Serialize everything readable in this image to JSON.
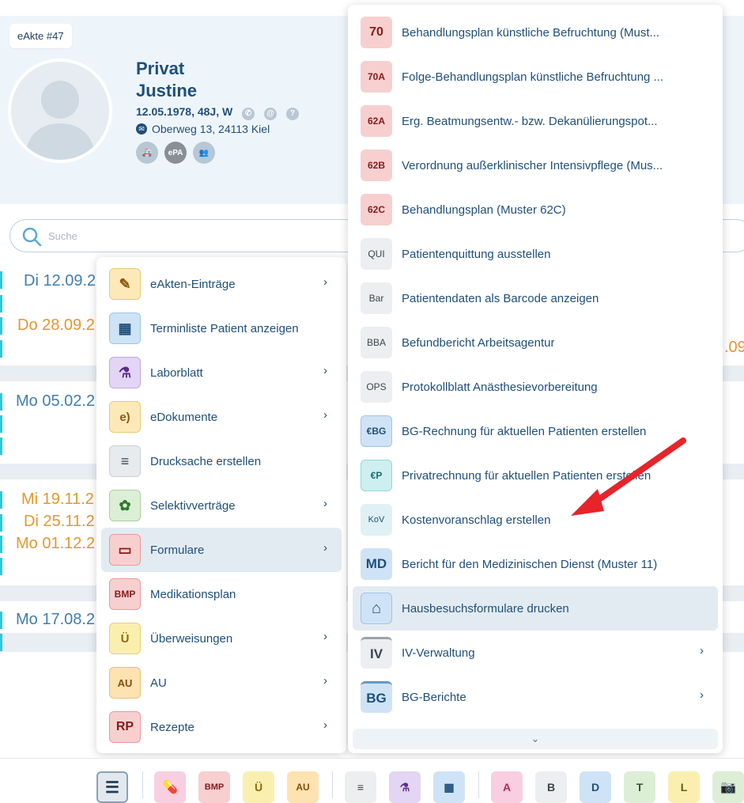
{
  "header": {
    "ekte_label": "eAkte #47",
    "last_name": "Privat",
    "first_name": "Justine",
    "dob_line": "12.05.1978, 48J, W",
    "address": "Oberweg 13, 24113 Kiel",
    "epa_label": "ePA"
  },
  "search": {
    "placeholder": "Suche"
  },
  "timeline": {
    "d1": "Di 12.09.2",
    "d2": "Do 28.09.2",
    "d2_right": ".09",
    "d3": "Mo 05.02.2",
    "d4": "Mi 19.11.2",
    "d5": "Di 25.11.2",
    "d6": "Mo 01.12.2",
    "d7": "Mo 17.08.2"
  },
  "menu1": [
    {
      "tile": "✎",
      "label": "eAkten-Einträge",
      "sub": true
    },
    {
      "tile": "▦",
      "label": "Terminliste Patient anzeigen",
      "sub": false
    },
    {
      "tile": "⚗",
      "label": "Laborblatt",
      "sub": true
    },
    {
      "tile": "e)",
      "label": "eDokumente",
      "sub": true
    },
    {
      "tile": "≡",
      "label": "Drucksache erstellen",
      "sub": false
    },
    {
      "tile": "✿",
      "label": "Selektivverträge",
      "sub": true
    },
    {
      "tile": "▭",
      "label": "Formulare",
      "sub": true
    },
    {
      "tile": "BMP",
      "label": "Medikationsplan",
      "sub": false
    },
    {
      "tile": "Ü",
      "label": "Überweisungen",
      "sub": true
    },
    {
      "tile": "AU",
      "label": "AU",
      "sub": true
    },
    {
      "tile": "RP",
      "label": "Rezepte",
      "sub": true
    }
  ],
  "menu2": [
    {
      "tile": "70",
      "label": "Behandlungsplan künstliche Befruchtung (Must...",
      "sub": false
    },
    {
      "tile": "70A",
      "label": "Folge-Behandlungsplan künstliche Befruchtung ...",
      "sub": false
    },
    {
      "tile": "62A",
      "label": "Erg. Beatmungsentw.- bzw. Dekanülierungspot...",
      "sub": false
    },
    {
      "tile": "62B",
      "label": "Verordnung außerklinischer Intensivpflege (Mus...",
      "sub": false
    },
    {
      "tile": "62C",
      "label": "Behandlungsplan (Muster 62C)",
      "sub": false
    },
    {
      "tile": "QUI",
      "label": "Patientenquittung ausstellen",
      "sub": false
    },
    {
      "tile": "Bar",
      "label": "Patientendaten als Barcode anzeigen",
      "sub": false
    },
    {
      "tile": "BBA",
      "label": "Befundbericht Arbeitsagentur",
      "sub": false
    },
    {
      "tile": "OPS",
      "label": "Protokollblatt Anästhesievorbereitung",
      "sub": false
    },
    {
      "tile": "€BG",
      "label": "BG-Rechnung für aktuellen Patienten erstellen",
      "sub": false
    },
    {
      "tile": "€P",
      "label": "Privatrechnung für aktuellen Patienten erstellen",
      "sub": false
    },
    {
      "tile": "KoV",
      "label": "Kostenvoranschlag erstellen",
      "sub": false
    },
    {
      "tile": "MD",
      "label": "Bericht für den Medizinischen Dienst (Muster 11)",
      "sub": false
    },
    {
      "tile": "⌂",
      "label": "Hausbesuchsformulare drucken",
      "sub": false
    },
    {
      "tile": "IV",
      "label": "IV-Verwaltung",
      "sub": true
    },
    {
      "tile": "BG",
      "label": "BG-Berichte",
      "sub": true
    }
  ],
  "toolbar": {
    "bmp": "BMP",
    "a": "A",
    "b": "B",
    "d": "D",
    "t": "T",
    "l": "L"
  },
  "colors": {
    "accent": "#1f4f7a",
    "orange": "#e8962f",
    "cyan": "#2fc6e0",
    "arrow": "#e8232a"
  }
}
